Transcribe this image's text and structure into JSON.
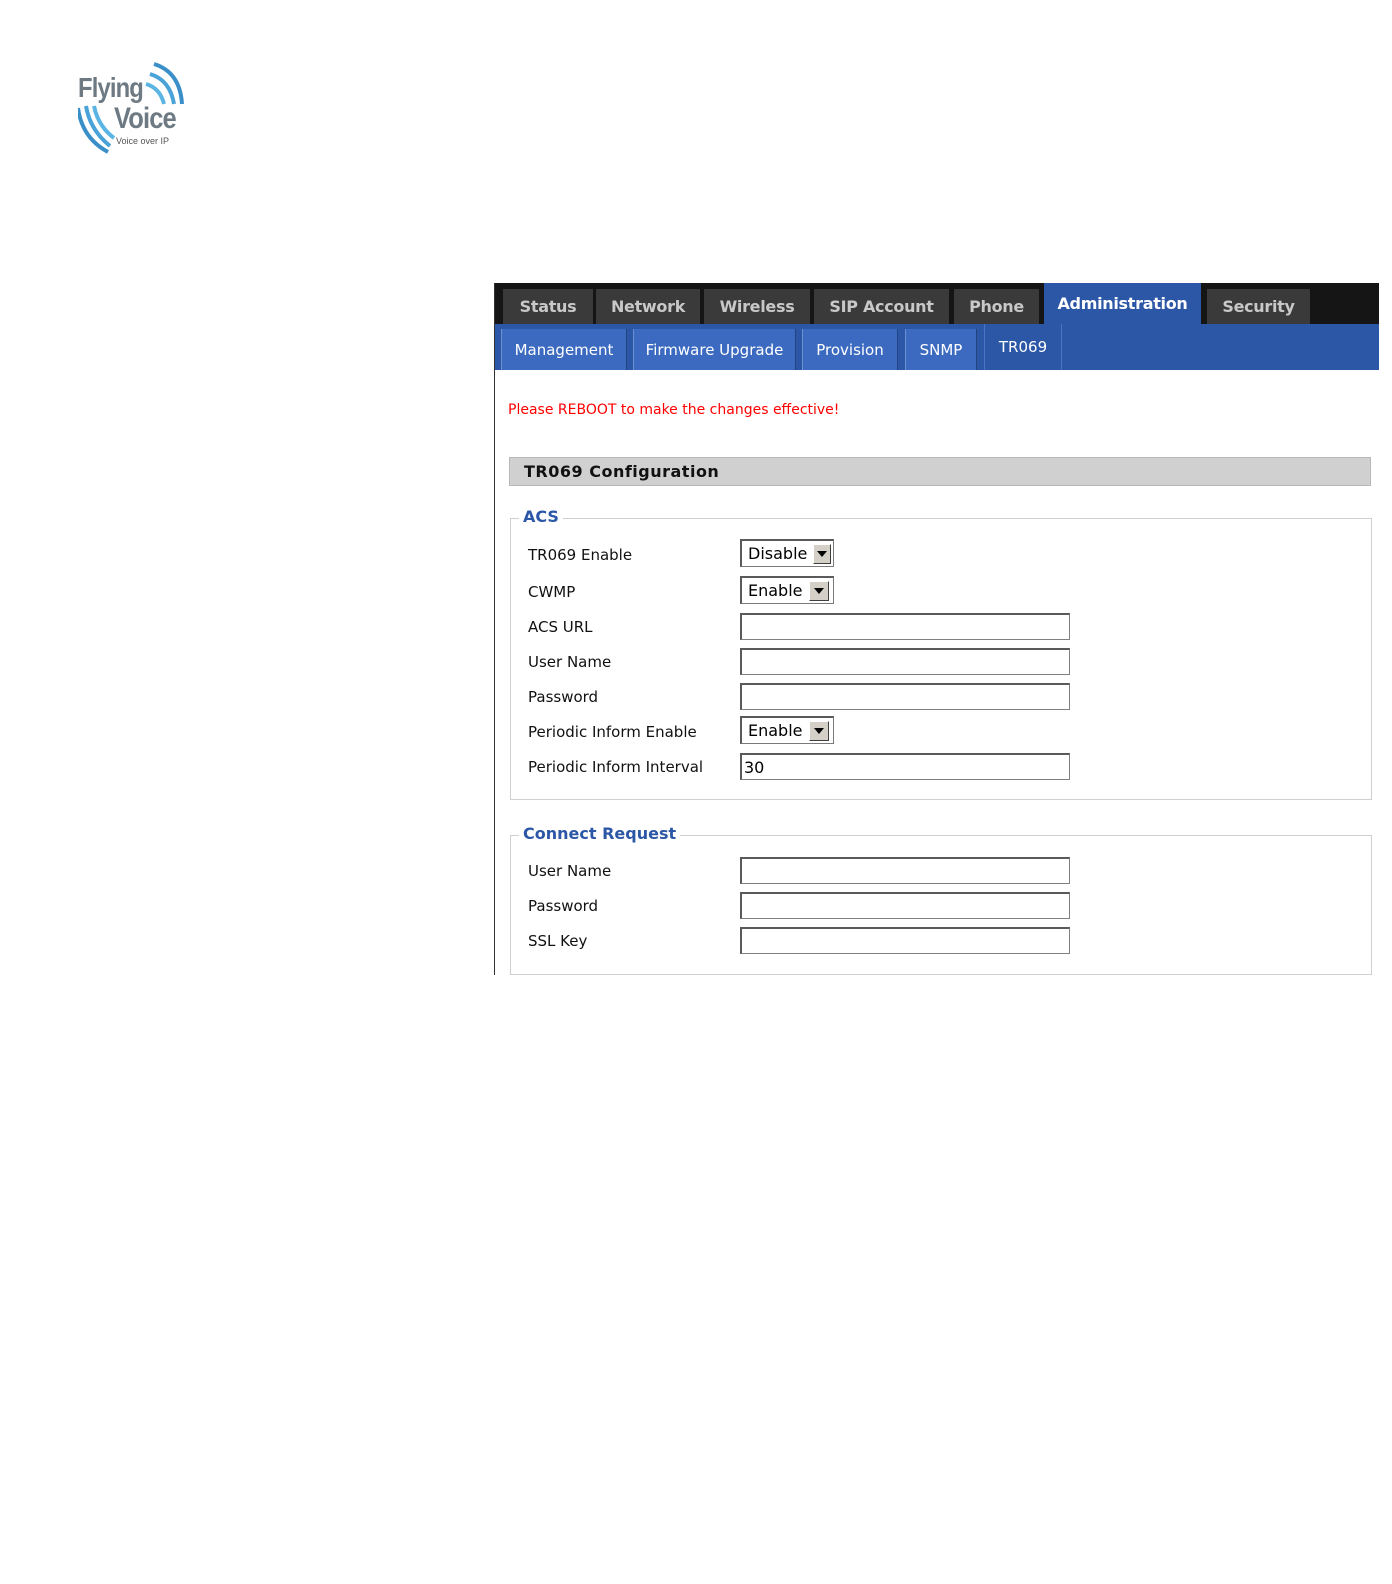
{
  "logo": {
    "line1": "Flying",
    "line2": "Voice",
    "tagline": "Voice over IP"
  },
  "top_tabs": [
    {
      "label": "Status",
      "active": false
    },
    {
      "label": "Network",
      "active": false
    },
    {
      "label": "Wireless",
      "active": false
    },
    {
      "label": "SIP Account",
      "active": false
    },
    {
      "label": "Phone",
      "active": false
    },
    {
      "label": "Administration",
      "active": true
    },
    {
      "label": "Security",
      "active": false
    }
  ],
  "sub_tabs": [
    {
      "label": "Management",
      "active": false
    },
    {
      "label": "Firmware Upgrade",
      "active": false
    },
    {
      "label": "Provision",
      "active": false
    },
    {
      "label": "SNMP",
      "active": false
    },
    {
      "label": "TR069",
      "active": true
    }
  ],
  "notice": "Please REBOOT to make the changes effective!",
  "section_title": "TR069 Configuration",
  "acs": {
    "legend": "ACS",
    "tr069_enable": {
      "label": "TR069 Enable",
      "value": "Disable"
    },
    "cwmp": {
      "label": "CWMP",
      "value": "Enable"
    },
    "acs_url": {
      "label": "ACS URL",
      "value": ""
    },
    "user_name": {
      "label": "User Name",
      "value": ""
    },
    "password": {
      "label": "Password",
      "value": ""
    },
    "periodic_inform_enable": {
      "label": "Periodic Inform Enable",
      "value": "Enable"
    },
    "periodic_inform_interval": {
      "label": "Periodic Inform Interval",
      "value": "30"
    }
  },
  "connect_request": {
    "legend": "Connect Request",
    "user_name": {
      "label": "User Name",
      "value": ""
    },
    "password": {
      "label": "Password",
      "value": ""
    },
    "ssl_key": {
      "label": "SSL Key",
      "value": ""
    }
  },
  "colors": {
    "nav_dark": "#151515",
    "tab_inactive": "#3a3a3a",
    "accent_blue": "#2c57a6",
    "notice_red": "#ff0000"
  },
  "icons": {
    "logo": "wifi-waves-logo",
    "dropdown": "chevron-down-icon"
  }
}
